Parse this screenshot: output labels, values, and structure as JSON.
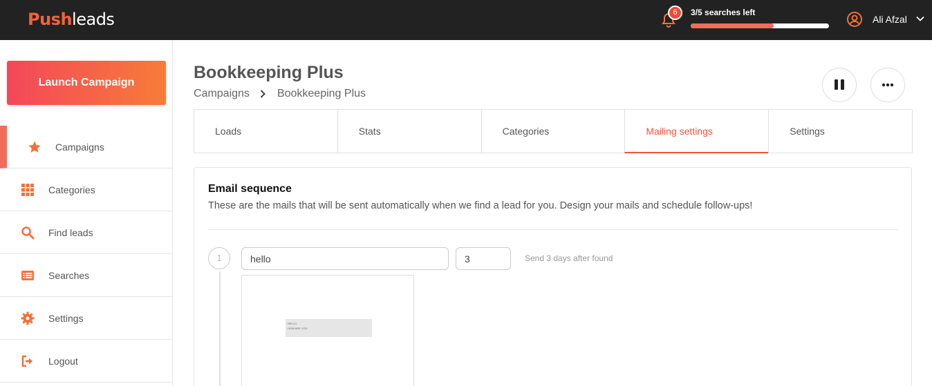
{
  "brand": {
    "part1": "Push",
    "part2": "leads"
  },
  "topbar": {
    "notifications_count": "6",
    "searches_text": "3/5 searches left",
    "searches_progress": 0.6,
    "user_name": "Ali Afzal"
  },
  "sidebar": {
    "launch_label": "Launch Campaign",
    "items": [
      {
        "label": "Campaigns",
        "icon": "star-icon",
        "active": true
      },
      {
        "label": "Categories",
        "icon": "grid-icon"
      },
      {
        "label": "Find leads",
        "icon": "search-icon"
      },
      {
        "label": "Searches",
        "icon": "list-icon"
      },
      {
        "label": "Settings",
        "icon": "gear-icon"
      },
      {
        "label": "Logout",
        "icon": "logout-icon"
      }
    ]
  },
  "page": {
    "title": "Bookkeeping Plus",
    "breadcrumb": [
      "Campaigns",
      "Bookkeeping Plus"
    ]
  },
  "tabs": [
    {
      "label": "Loads"
    },
    {
      "label": "Stats"
    },
    {
      "label": "Categories"
    },
    {
      "label": "Mailing settings",
      "active": true
    },
    {
      "label": "Settings"
    }
  ],
  "email_sequence": {
    "title": "Email sequence",
    "description": "These are the mails that will be sent automatically when we find a lead for you. Design your mails and schedule follow-ups!",
    "steps": [
      {
        "number": "1",
        "subject": "hello",
        "days": "3",
        "note": "Send 3 days after found",
        "preview_lines": [
          "HELLO",
          "HOW ARE YOU"
        ]
      }
    ]
  },
  "colors": {
    "accent": "#f26c5c",
    "topbar": "#222222",
    "gradient_start": "#f4475a",
    "gradient_end": "#f77c38"
  }
}
